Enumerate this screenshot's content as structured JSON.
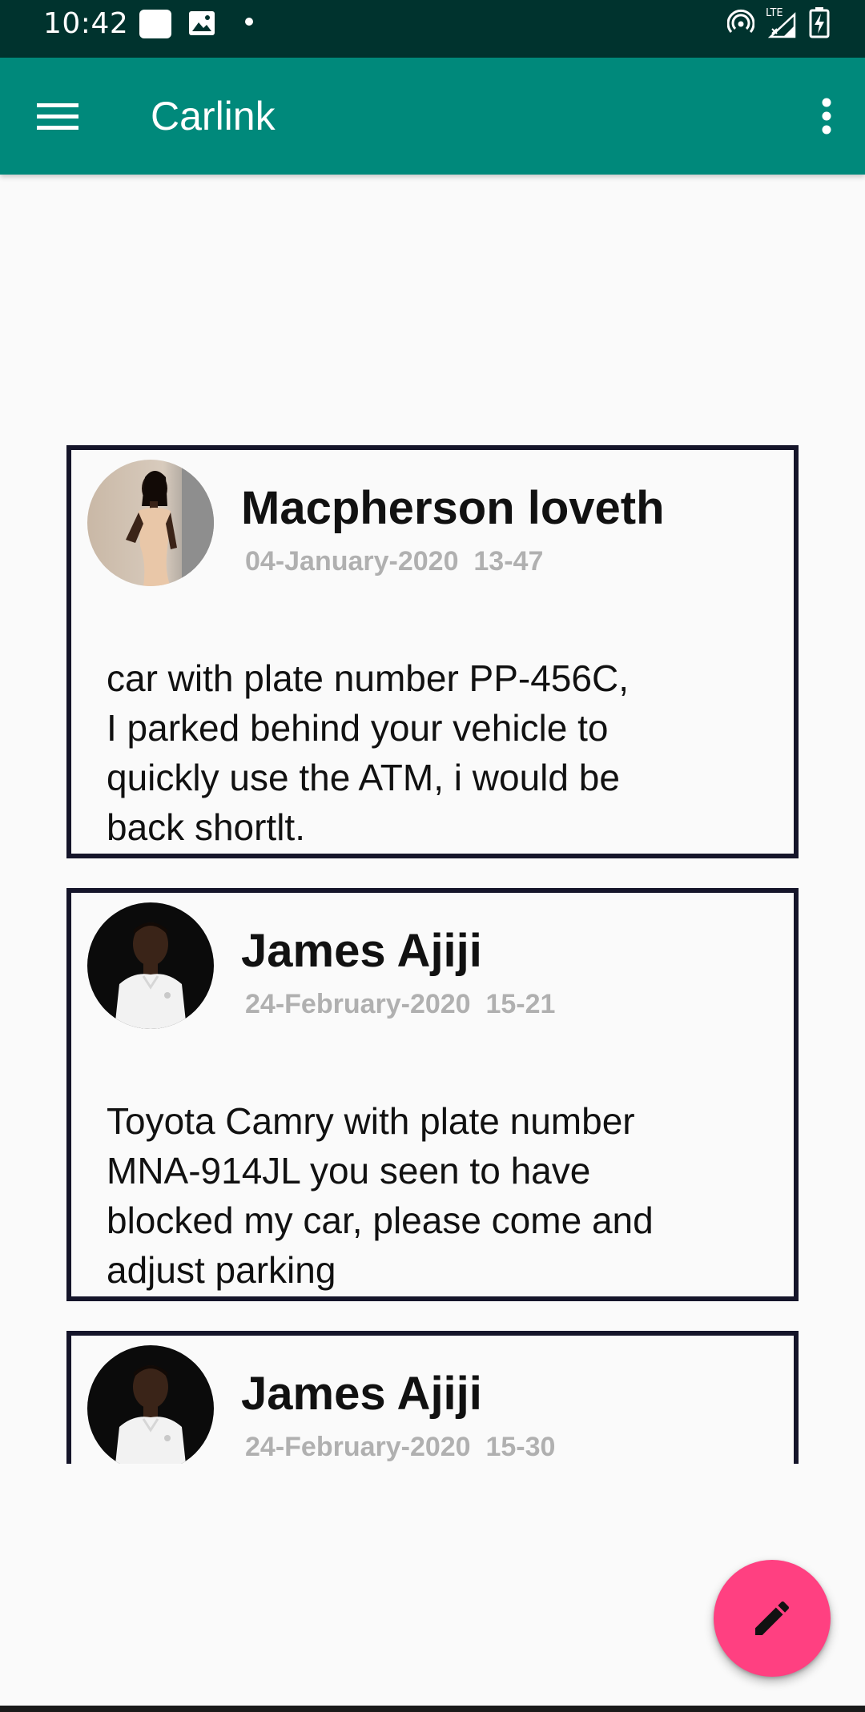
{
  "status_bar": {
    "time": "10:42",
    "network_label": "LTE",
    "icons": [
      "notification-square-icon",
      "image-notification-icon",
      "dot-icon",
      "hotspot-icon",
      "signal-icon",
      "battery-charging-icon"
    ]
  },
  "app_bar": {
    "title": "Carlink",
    "menu_icon": "hamburger-menu-icon",
    "overflow_icon": "more-vert-icon"
  },
  "posts": [
    {
      "author": "Macpherson loveth",
      "timestamp": "04-January-2020  13-47",
      "message": "car with plate number PP-456C,\nI parked behind your vehicle to\nquickly use the ATM, i would be\nback shortlt.",
      "avatar_icon": "avatar-woman-icon"
    },
    {
      "author": "James Ajiji",
      "timestamp": "24-February-2020  15-21",
      "message": "Toyota Camry with plate number\nMNA-914JL you seen to have\nblocked my car, please come and\nadjust parking",
      "avatar_icon": "avatar-man-icon"
    },
    {
      "author": "James Ajiji",
      "timestamp": "24-February-2020  15-30",
      "message": "",
      "avatar_icon": "avatar-man-icon"
    }
  ],
  "fab": {
    "icon": "edit-pencil-icon"
  },
  "colors": {
    "status_bar": "#00332e",
    "app_bar": "#00897b",
    "card_border": "#15152a",
    "timestamp": "#b0b0b0",
    "fab": "#ff4081",
    "background": "#fafafa"
  }
}
